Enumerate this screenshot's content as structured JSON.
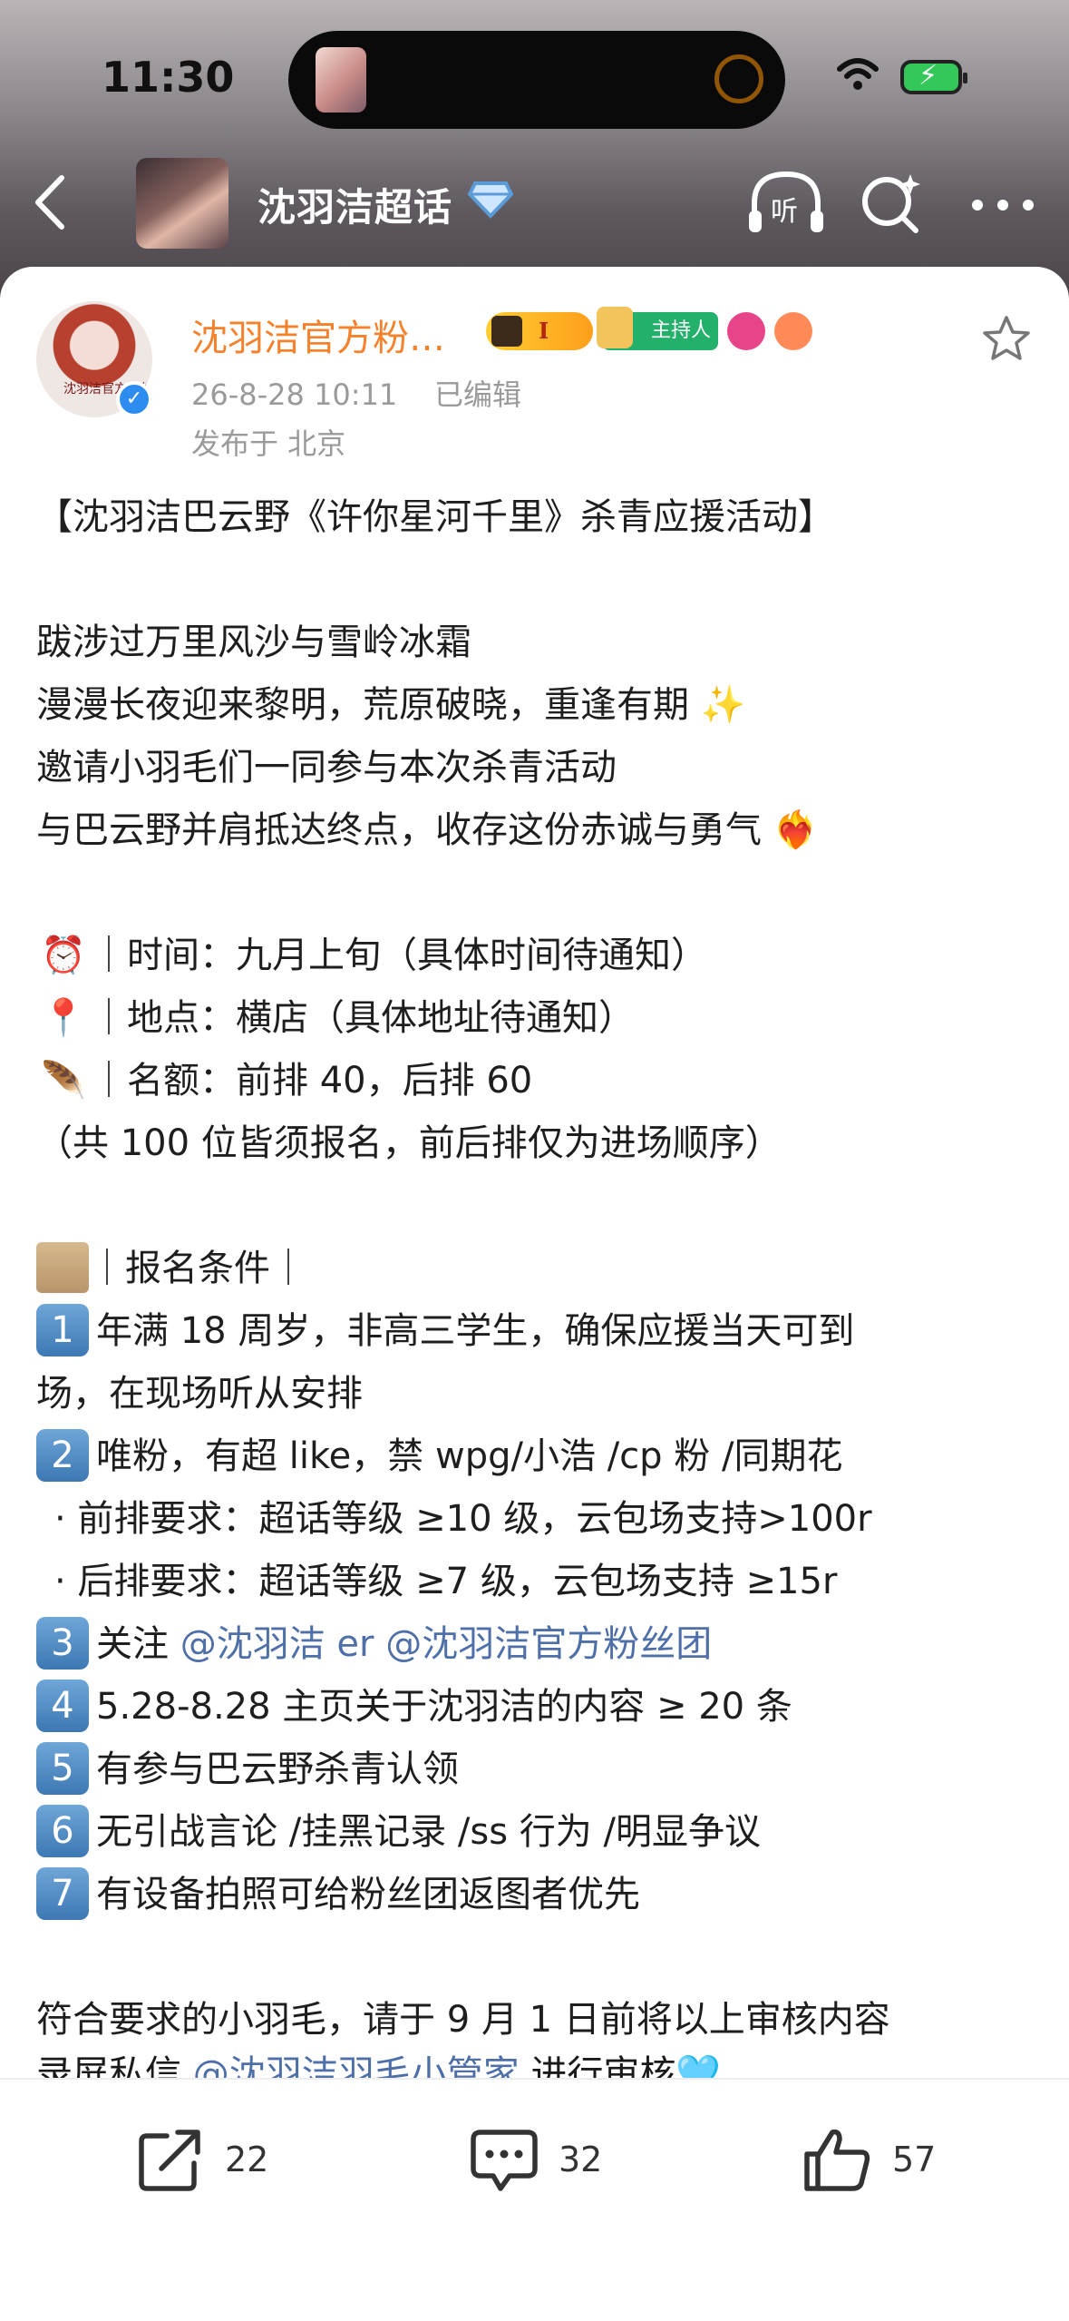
{
  "status": {
    "time": "11:30"
  },
  "nav": {
    "title": "沈羽洁超话",
    "listen_label": "听"
  },
  "post": {
    "author": "沈羽洁官方粉…",
    "badges": {
      "level": "I",
      "host": "主持人"
    },
    "avatar_caption": "沈羽洁官方粉丝",
    "date": "26-8-28 10:11",
    "edited": "已编辑",
    "location": "发布于 北京",
    "lines": [
      "【沈羽洁巴云野《许你星河千里》杀青应援活动】",
      "",
      "跋涉过万里风沙与雪岭冰霜",
      "漫漫长夜迎来黎明，荒原破晓，重逢有期 ✨",
      "邀请小羽毛们一同参与本次杀青活动",
      "与巴云野并肩抵达终点，收存这份赤诚与勇气 ❤️‍🔥",
      "",
      "｜时间：九月上旬（具体时间待通知）",
      "｜地点：横店（具体地址待通知）",
      "｜名额：前排 40，后排 60",
      "（共 100 位皆须报名，前后排仅为进场顺序）",
      "",
      "｜报名条件｜",
      "年满 18 周岁，非高三学生，确保应援当天可到",
      "场，在现场听从安排",
      "唯粉，有超 like，禁 wpg/小浩 /cp 粉 /同期花",
      "· 前排要求：超话等级 ≥10 级，云包场支持>100r",
      "· 后排要求：超话等级 ≥7 级，云包场支持 ≥15r",
      "关注",
      "@沈羽洁 er @沈羽洁官方粉丝团",
      "5.28-8.28 主页关于沈羽洁的内容 ≥ 20 条",
      "有参与巴云野杀青认领",
      "无引战言论 /挂黑记录 /ss 行为 /明显争议",
      "有设备拍照可给粉丝团返图者优先",
      "",
      "符合要求的小羽毛，请于 9 月 1 日前将以上审核内容",
      "录屏私信",
      "@沈羽洁羽毛小管家",
      "进行审核🩵"
    ],
    "emoji": {
      "time": "⏰",
      "place": "📍",
      "quota": "🪶"
    },
    "keycaps": [
      "1",
      "2",
      "3",
      "4",
      "5",
      "6",
      "7"
    ]
  },
  "actions": {
    "share_count": "22",
    "comment_count": "32",
    "like_count": "57"
  }
}
